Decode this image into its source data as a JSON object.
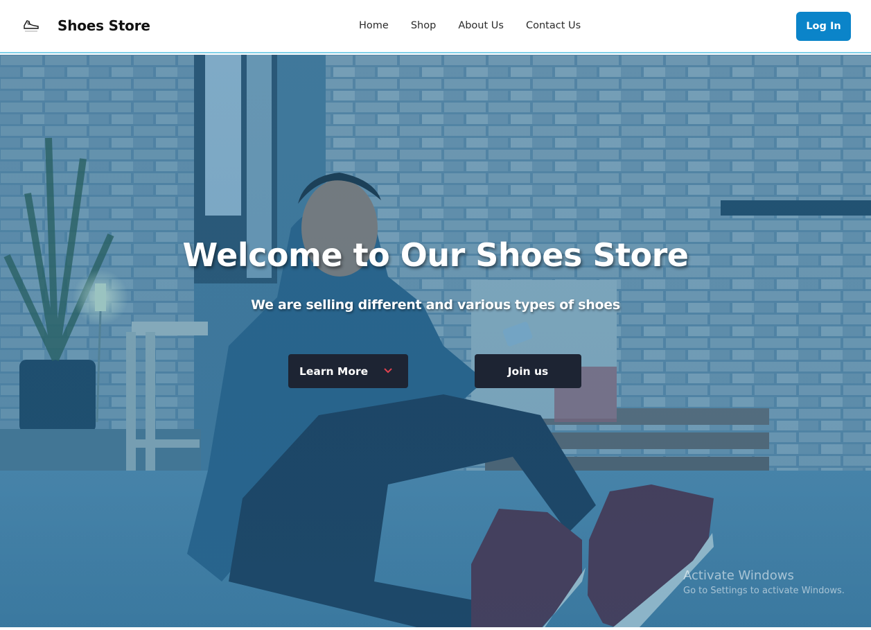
{
  "header": {
    "brand": "Shoes Store",
    "logo_icon": "sneaker-logo-icon",
    "nav": [
      "Home",
      "Shop",
      "About Us",
      "Contact Us"
    ],
    "login_label": "Log In",
    "accent": "#0b84c9"
  },
  "hero": {
    "title": "Welcome to Our Shoes Store",
    "subtitle": "We are selling different and various types of shoes",
    "learn_more_label": "Learn More",
    "learn_more_icon": "chevron-down-icon",
    "join_label": "Join us",
    "button_color": "#1d2433",
    "chevron_color": "#e0434f"
  },
  "watermark": {
    "line1": "Activate Windows",
    "line2": "Go to Settings to activate Windows."
  }
}
